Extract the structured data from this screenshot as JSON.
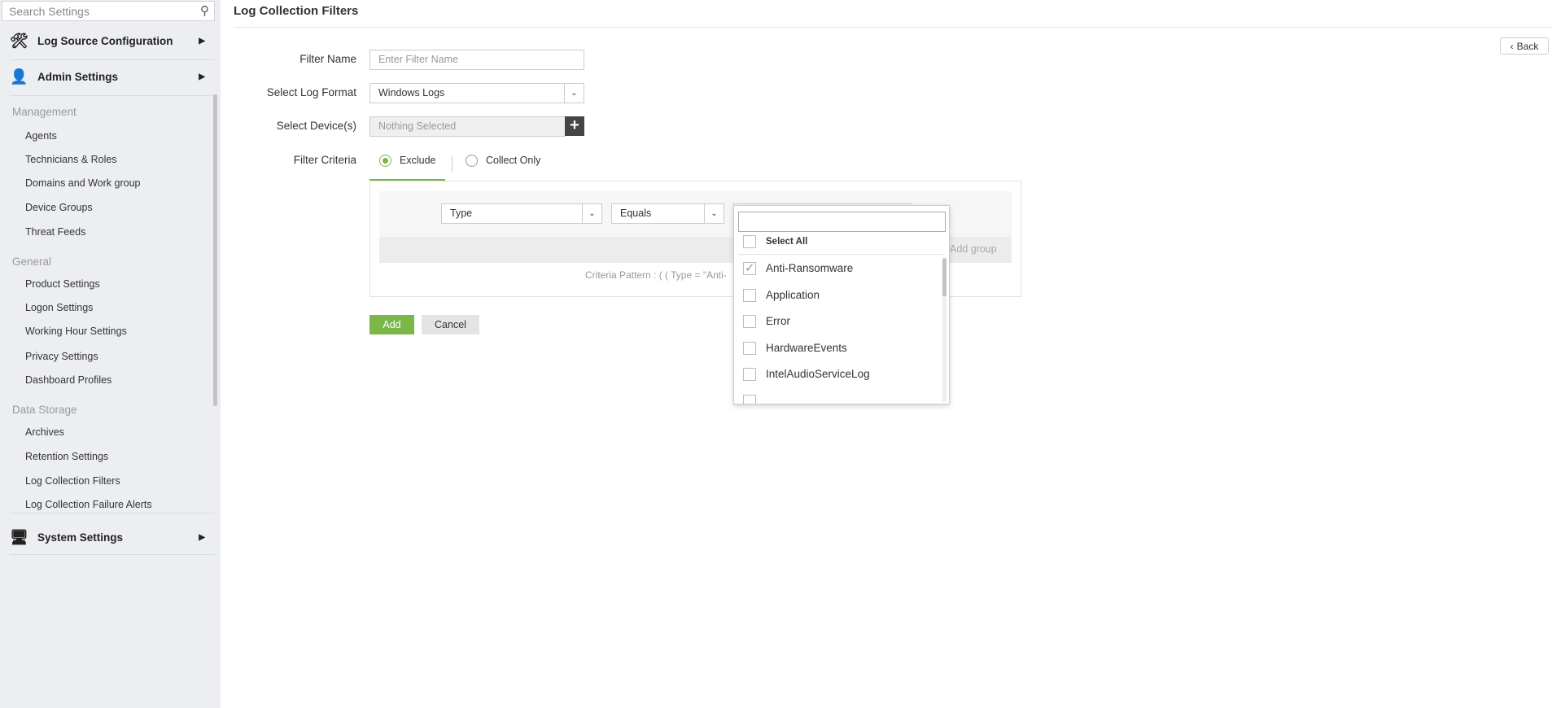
{
  "sidebar": {
    "search_placeholder": "Search Settings",
    "sections": [
      {
        "label": "Log Source Configuration"
      },
      {
        "label": "Admin Settings"
      },
      {
        "label": "System Settings"
      }
    ],
    "groups": [
      {
        "label": "Management",
        "items": [
          "Agents",
          "Technicians & Roles",
          "Domains and Work group",
          "Device Groups",
          "Threat Feeds"
        ]
      },
      {
        "label": "General",
        "items": [
          "Product Settings",
          "Logon Settings",
          "Working Hour Settings",
          "Privacy Settings",
          "Dashboard Profiles"
        ]
      },
      {
        "label": "Data Storage",
        "items": [
          "Archives",
          "Retention Settings",
          "Log Collection Filters",
          "Log Collection Failure Alerts"
        ]
      }
    ]
  },
  "page": {
    "title": "Log Collection Filters",
    "back_label": "Back"
  },
  "form": {
    "filter_name_label": "Filter Name",
    "filter_name_placeholder": "Enter Filter Name",
    "log_format_label": "Select Log Format",
    "log_format_value": "Windows Logs",
    "devices_label": "Select Device(s)",
    "devices_value": "Nothing Selected",
    "criteria_label": "Filter Criteria",
    "tabs": [
      {
        "label": "Exclude",
        "selected": true
      },
      {
        "label": "Collect Only",
        "selected": false
      }
    ],
    "field_value": "Type",
    "operator_value": "Equals",
    "add_group_label": "Add group",
    "criteria_pattern": "Criteria Pattern : ( ( Type = \"Anti-",
    "add_label": "Add",
    "cancel_label": "Cancel"
  },
  "dropdown": {
    "select_all_label": "Select All",
    "options": [
      {
        "label": "Anti-Ransomware",
        "checked": true
      },
      {
        "label": "Application",
        "checked": false
      },
      {
        "label": "Error",
        "checked": false
      },
      {
        "label": "HardwareEvents",
        "checked": false
      },
      {
        "label": "IntelAudioServiceLog",
        "checked": false
      }
    ]
  },
  "colors": {
    "accent": "#7ab648",
    "sidebar_bg": "#eceef1"
  }
}
